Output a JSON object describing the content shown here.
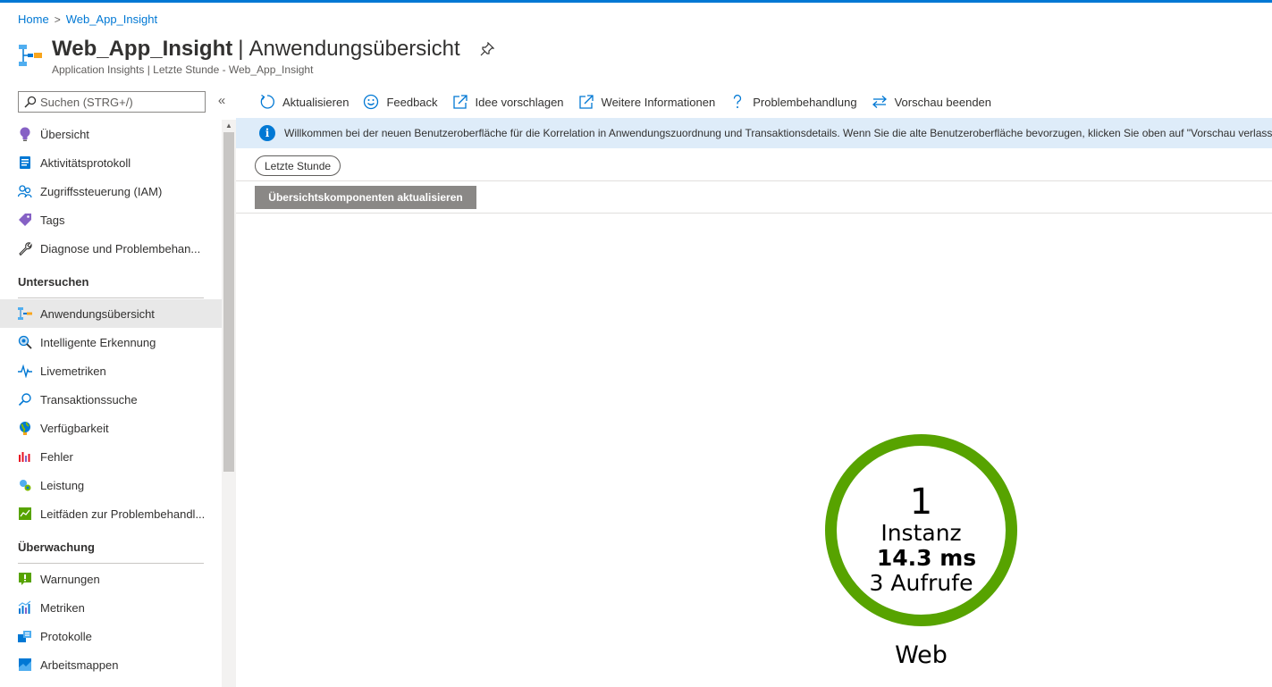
{
  "breadcrumb": {
    "home": "Home",
    "separator": ">",
    "current": "Web_App_Insight"
  },
  "header": {
    "title": "Web_App_Insight",
    "pipe": "|",
    "page": "Anwendungsübersicht",
    "subtitle": "Application Insights | Letzte Stunde - Web_App_Insight"
  },
  "sidebar": {
    "search_placeholder": "Suchen (STRG+/)",
    "collapse": "«",
    "items_top": [
      {
        "label": "Übersicht",
        "icon": "lightbulb-icon"
      },
      {
        "label": "Aktivitätsprotokoll",
        "icon": "activity-log-icon"
      },
      {
        "label": "Zugriffssteuerung (IAM)",
        "icon": "people-icon"
      },
      {
        "label": "Tags",
        "icon": "tag-icon"
      },
      {
        "label": "Diagnose und Problembehan...",
        "icon": "wrench-icon"
      }
    ],
    "section_investigate": "Untersuchen",
    "items_investigate": [
      {
        "label": "Anwendungsübersicht",
        "icon": "app-map-icon"
      },
      {
        "label": "Intelligente Erkennung",
        "icon": "smart-detection-icon"
      },
      {
        "label": "Livemetriken",
        "icon": "pulse-icon"
      },
      {
        "label": "Transaktionssuche",
        "icon": "search-icon"
      },
      {
        "label": "Verfügbarkeit",
        "icon": "globe-icon"
      },
      {
        "label": "Fehler",
        "icon": "failures-icon"
      },
      {
        "label": "Leistung",
        "icon": "performance-icon"
      },
      {
        "label": "Leitfäden zur Problembehandl...",
        "icon": "workbook-icon"
      }
    ],
    "section_monitoring": "Überwachung",
    "items_monitoring": [
      {
        "label": "Warnungen",
        "icon": "alert-icon"
      },
      {
        "label": "Metriken",
        "icon": "metrics-icon"
      },
      {
        "label": "Protokolle",
        "icon": "logs-icon"
      },
      {
        "label": "Arbeitsmappen",
        "icon": "workbooks-icon"
      }
    ]
  },
  "toolbar": {
    "refresh": "Aktualisieren",
    "feedback": "Feedback",
    "suggest": "Idee vorschlagen",
    "more_info": "Weitere Informationen",
    "troubleshoot": "Problembehandlung",
    "end_preview": "Vorschau beenden"
  },
  "info": {
    "icon": "i",
    "text": "Willkommen bei der neuen Benutzeroberfläche für die Korrelation in Anwendungszuordnung und Transaktionsdetails. Wenn Sie die alte Benutzeroberfläche bevorzugen, klicken Sie oben auf \"Vorschau verlassen\""
  },
  "time_range": "Letzte Stunde",
  "refresh_components": "Übersichtskomponenten aktualisieren",
  "node": {
    "count": "1",
    "instances": "Instanz",
    "duration": "14.3 ms",
    "calls": "3 Aufrufe",
    "label": "Web",
    "ring_color": "#57a300"
  },
  "colors": {
    "accent": "#0078d4",
    "info_bg": "#deecf9"
  }
}
